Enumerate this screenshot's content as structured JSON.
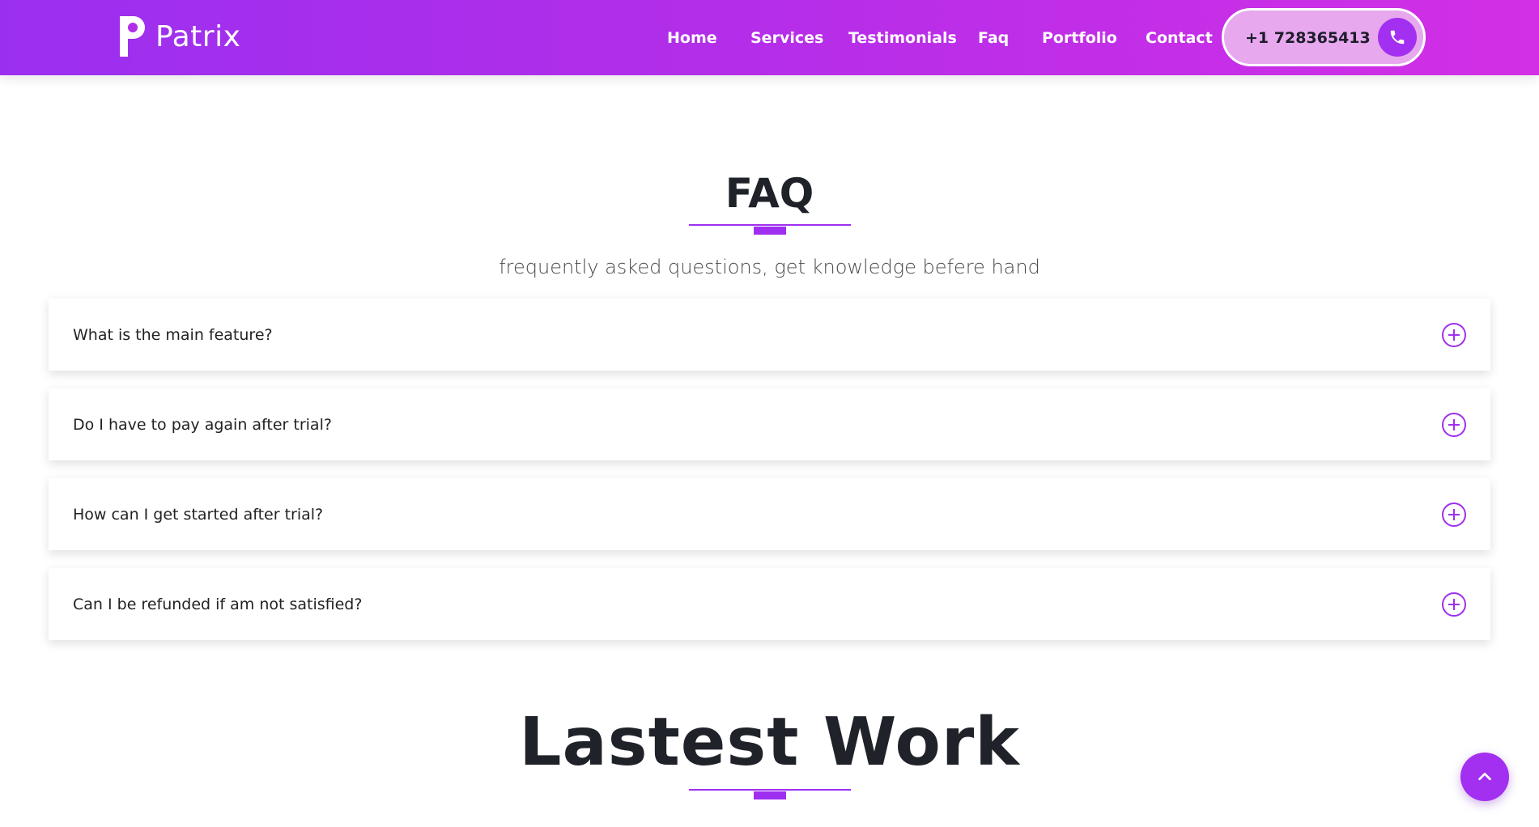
{
  "colors": {
    "accent": "#9f2ff0",
    "header_gradient_start": "#9b2ff0",
    "header_gradient_end": "#d22fe6",
    "phone_pill_bg": "#e7a8ee"
  },
  "header": {
    "brand": {
      "icon": "p-logo-icon",
      "name": "Patrix"
    },
    "nav": [
      {
        "label": "Home"
      },
      {
        "label": "Services"
      },
      {
        "label": "Testimonials"
      },
      {
        "label": "Faq"
      },
      {
        "label": "Portfolio"
      },
      {
        "label": "Contact"
      }
    ],
    "phone": {
      "number": "+1 728365413",
      "icon": "phone-icon"
    }
  },
  "faq": {
    "title": "FAQ",
    "subtitle": "frequently asked questions, get knowledge befere hand",
    "items": [
      {
        "question": "What is the main feature?",
        "icon": "plus-circle-icon"
      },
      {
        "question": "Do I have to pay again after trial?",
        "icon": "plus-circle-icon"
      },
      {
        "question": "How can I get started after trial?",
        "icon": "plus-circle-icon"
      },
      {
        "question": "Can I be refunded if am not satisfied?",
        "icon": "plus-circle-icon"
      }
    ]
  },
  "latest_work": {
    "title": "Lastest Work"
  },
  "back_to_top": {
    "icon": "chevron-up-icon"
  }
}
